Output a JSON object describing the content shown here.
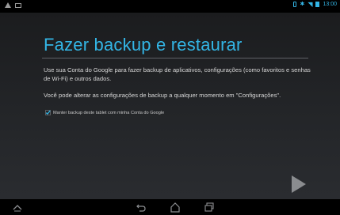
{
  "status_bar": {
    "clock": "13:00",
    "accent_color": "#33b5e5",
    "left_icons": [
      "warning-icon",
      "image-notification-icon"
    ],
    "right_icons": [
      "phone-icon",
      "bluetooth-icon",
      "wifi-icon",
      "battery-icon"
    ]
  },
  "setup": {
    "title": "Fazer backup e restaurar",
    "paragraph1": "Use sua Conta do Google para fazer backup de aplicativos, configurações (como favoritos e senhas de Wi-Fi) e outros dados.",
    "paragraph2": "Você pode alterar as configurações de backup a qualquer momento em \"Configurações\".",
    "checkbox_label": "Manter backup deste tablet com minha Conta do Google",
    "checkbox_checked": true
  },
  "navigation": {
    "next_icon": "next-arrow-icon",
    "buttons": [
      "keyboard-hide-icon",
      "back-icon",
      "home-icon",
      "recent-apps-icon"
    ]
  }
}
